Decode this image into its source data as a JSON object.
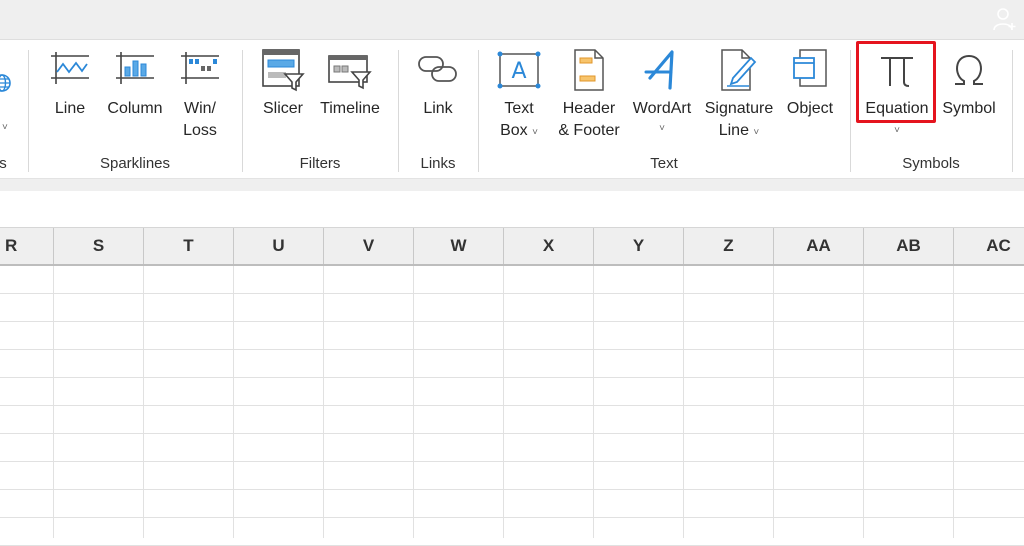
{
  "titlebar": {
    "share_icon": "person-add-icon"
  },
  "ribbon": {
    "partial_left_group": {
      "label_fragment": "s",
      "icon": "globe-icon"
    },
    "groups": [
      {
        "name": "Sparklines",
        "buttons": [
          {
            "label": "Line",
            "icon": "sparkline-line-icon"
          },
          {
            "label": "Column",
            "icon": "sparkline-column-icon"
          },
          {
            "label_line1": "Win/",
            "label_line2": "Loss",
            "icon": "sparkline-winloss-icon"
          }
        ]
      },
      {
        "name": "Filters",
        "buttons": [
          {
            "label": "Slicer",
            "icon": "slicer-icon"
          },
          {
            "label": "Timeline",
            "icon": "timeline-icon"
          }
        ]
      },
      {
        "name": "Links",
        "buttons": [
          {
            "label": "Link",
            "icon": "link-icon"
          }
        ]
      },
      {
        "name": "Text",
        "buttons": [
          {
            "label_line1": "Text",
            "label_line2": "Box",
            "icon": "text-box-icon",
            "dropdown": true
          },
          {
            "label_line1": "Header",
            "label_line2": "& Footer",
            "icon": "header-footer-icon"
          },
          {
            "label": "WordArt",
            "icon": "wordart-icon",
            "dropdown": true
          },
          {
            "label_line1": "Signature",
            "label_line2": "Line",
            "icon": "signature-line-icon",
            "dropdown": true
          },
          {
            "label": "Object",
            "icon": "object-icon"
          }
        ]
      },
      {
        "name": "Symbols",
        "buttons": [
          {
            "label": "Equation",
            "icon": "pi-icon",
            "dropdown": true,
            "highlighted": true
          },
          {
            "label": "Symbol",
            "icon": "omega-icon"
          }
        ]
      }
    ],
    "chevron": "˅",
    "highlight_color": "#e5141e",
    "icon_blue": "#2b88d8",
    "icon_orange": "#f0a030"
  },
  "sheet": {
    "columns": [
      "R",
      "S",
      "T",
      "U",
      "V",
      "W",
      "X",
      "Y",
      "Z",
      "AA",
      "AB",
      "AC"
    ],
    "visible_rows": 10
  }
}
